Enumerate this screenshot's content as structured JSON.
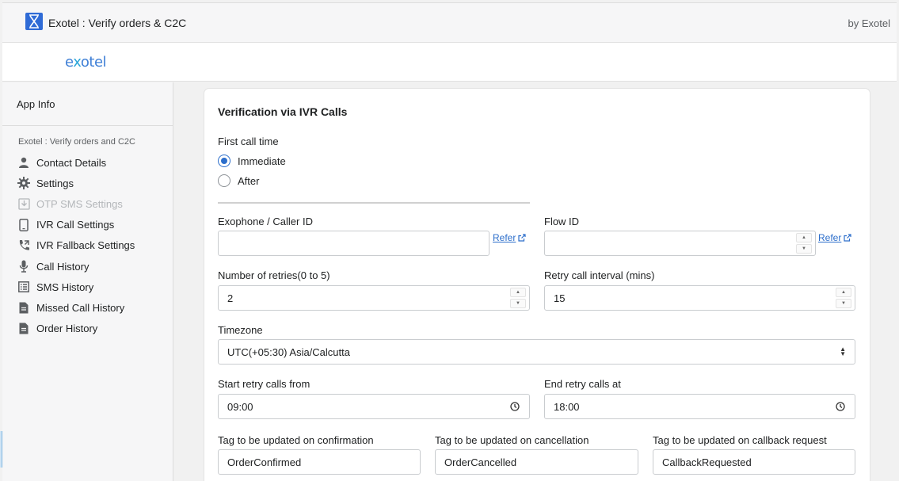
{
  "header": {
    "app_title": "Exotel : Verify orders & C2C",
    "by_label": "by Exotel",
    "logo_text_pre": "e",
    "logo_text_x": "x",
    "logo_text_post": "otel"
  },
  "sidebar": {
    "app_info": "App Info",
    "section_title": "Exotel : Verify orders and C2C",
    "items": [
      {
        "label": "Contact Details",
        "icon": "person-icon"
      },
      {
        "label": "Settings",
        "icon": "gear-icon"
      },
      {
        "label": "OTP SMS Settings",
        "icon": "download-icon",
        "disabled": true
      },
      {
        "label": "IVR Call Settings",
        "icon": "mobile-phone-icon"
      },
      {
        "label": "IVR Fallback Settings",
        "icon": "phone-forward-icon"
      },
      {
        "label": "Call History",
        "icon": "microphone-icon"
      },
      {
        "label": "SMS History",
        "icon": "list-icon"
      },
      {
        "label": "Missed Call History",
        "icon": "document-icon"
      },
      {
        "label": "Order History",
        "icon": "document-icon"
      }
    ]
  },
  "form": {
    "title": "Verification via IVR Calls",
    "first_call_time": {
      "label": "First call time",
      "options": [
        "Immediate",
        "After"
      ],
      "selected": "Immediate"
    },
    "exophone": {
      "label": "Exophone / Caller ID",
      "value": "",
      "refer_label": "Refer"
    },
    "flow_id": {
      "label": "Flow ID",
      "value": "",
      "refer_label": "Refer"
    },
    "retries": {
      "label": "Number of retries(0 to 5)",
      "value": "2"
    },
    "retry_interval": {
      "label": "Retry call interval (mins)",
      "value": "15"
    },
    "timezone": {
      "label": "Timezone",
      "value": "UTC(+05:30) Asia/Calcutta"
    },
    "start_retry": {
      "label": "Start retry calls from",
      "value": "09:00"
    },
    "end_retry": {
      "label": "End retry calls at",
      "value": "18:00"
    },
    "tag_confirm": {
      "label": "Tag to be updated on confirmation",
      "value": "OrderConfirmed"
    },
    "tag_cancel": {
      "label": "Tag to be updated on cancellation",
      "value": "OrderCancelled"
    },
    "tag_callback": {
      "label": "Tag to be updated on callback request",
      "value": "CallbackRequested"
    }
  },
  "colors": {
    "accent": "#2c6ecb",
    "app_icon": "#2f6bd6",
    "logo": "#3e7fd6"
  }
}
